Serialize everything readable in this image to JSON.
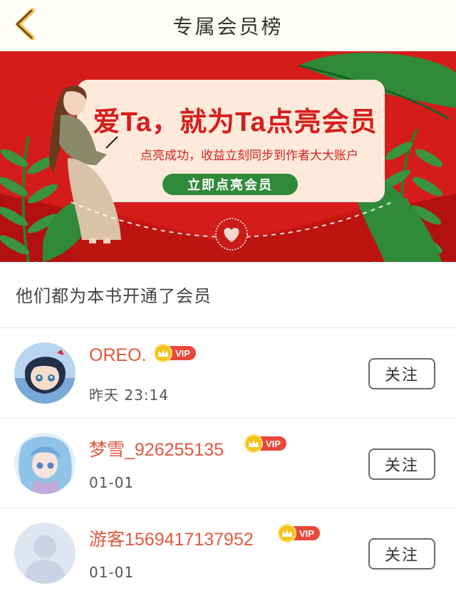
{
  "header": {
    "title": "专属会员榜",
    "back_icon": "chevron-left-icon",
    "accent_color": "#f3b53a"
  },
  "banner": {
    "headline": "爱Ta，就为Ta点亮会员",
    "subtitle": "点亮成功，收益立刻同步到作者大大账户",
    "cta_label": "立即点亮会员",
    "bg_color": "#d41d1a",
    "card_color": "#fdeadb",
    "cta_color": "#2f8a3a"
  },
  "section": {
    "title": "他们都为本书开通了会员"
  },
  "members": [
    {
      "name": "OREO.",
      "vip_label": "VIP",
      "time": "昨天 23:14",
      "follow_label": "关注",
      "avatar": "anime-girl-avatar"
    },
    {
      "name": "梦雪_926255135",
      "vip_label": "VIP",
      "time": "01-01",
      "follow_label": "关注",
      "avatar": "blue-hair-anime-avatar"
    },
    {
      "name": "游客1569417137952",
      "vip_label": "VIP",
      "time": "01-01",
      "follow_label": "关注",
      "avatar": "default-user-avatar"
    }
  ],
  "colors": {
    "name_color": "#e0583d",
    "vip_crown": "#f5c21b",
    "vip_tag": "#e9473a"
  }
}
